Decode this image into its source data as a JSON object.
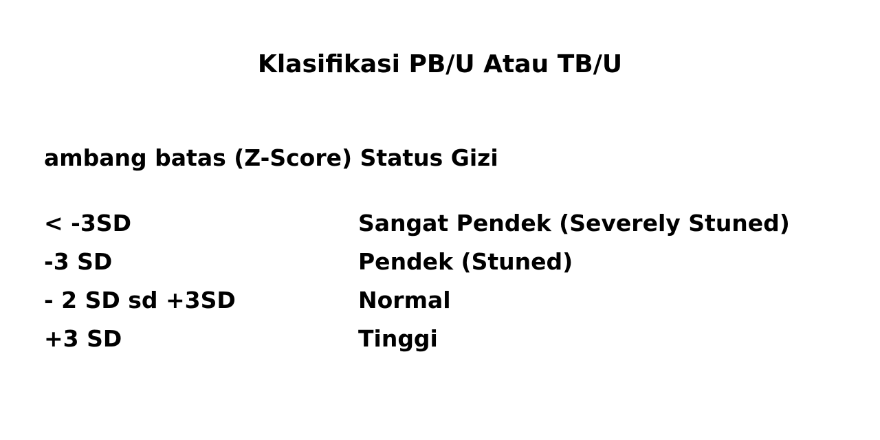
{
  "title": "Klasifikasi PB/U Atau TB/U",
  "subtitle": "ambang batas (Z-Score) Status Gizi",
  "rows": [
    {
      "threshold": "< -3SD",
      "status": "Sangat Pendek (Severely Stuned)"
    },
    {
      "threshold": "-3 SD",
      "status": "Pendek (Stuned)"
    },
    {
      "threshold": "- 2 SD sd +3SD",
      "status": "Normal"
    },
    {
      "threshold": "+3 SD",
      "status": "Tinggi"
    }
  ]
}
